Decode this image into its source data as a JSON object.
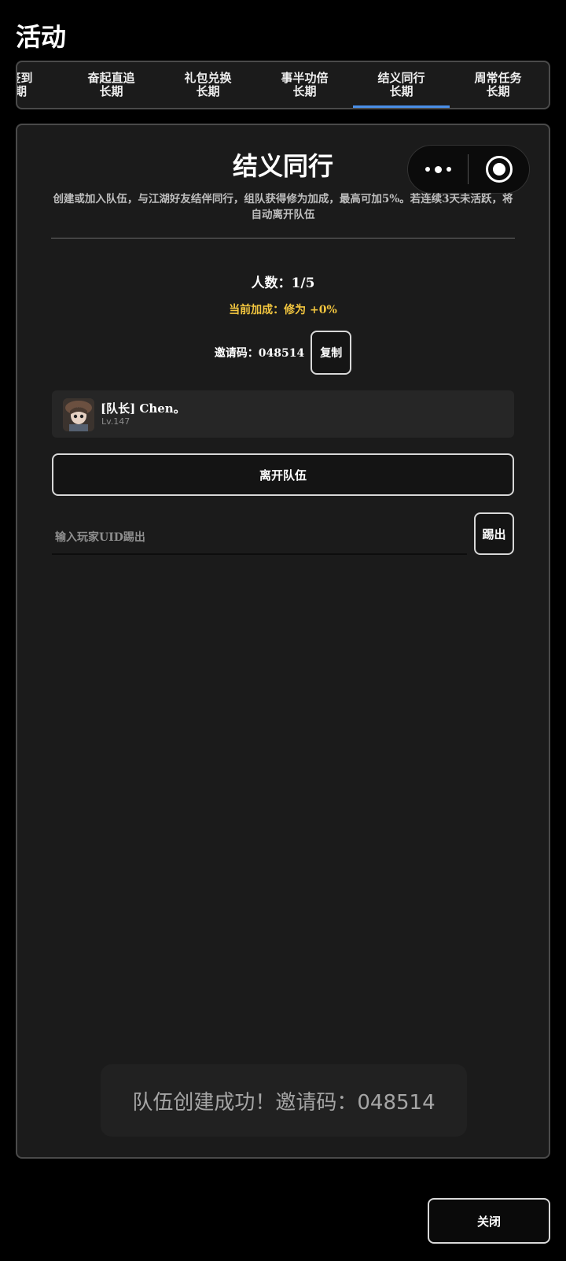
{
  "page": {
    "title": "活动"
  },
  "tabs": [
    {
      "label": "签到",
      "sub": "期",
      "active": false
    },
    {
      "label": "奋起直追",
      "sub": "长期",
      "active": false
    },
    {
      "label": "礼包兑换",
      "sub": "长期",
      "active": false
    },
    {
      "label": "事半功倍",
      "sub": "长期",
      "active": false
    },
    {
      "label": "结义同行",
      "sub": "长期",
      "active": true
    },
    {
      "label": "周常任务",
      "sub": "长期",
      "active": false
    }
  ],
  "capsule": {
    "menu_icon": "more-dots-icon",
    "close_icon": "target-ring-icon"
  },
  "team": {
    "title": "结义同行",
    "description": "创建或加入队伍，与江湖好友结伴同行，组队获得修为加成，最高可加5%。若连续3天未活跃，将自动离开队伍",
    "member_count": "人数：1/5",
    "bonus": "当前加成：修为 +0%",
    "invite": "邀请码：048514",
    "copy_label": "复制",
    "members": [
      {
        "name": "[队长] Chen。",
        "level": "Lv.147",
        "avatar_icon": "avatar-icon"
      }
    ],
    "leave_label": "离开队伍",
    "kick_placeholder": "输入玩家UID踢出",
    "kick_label": "踢出"
  },
  "toast": {
    "message": "队伍创建成功！邀请码：048514"
  },
  "footer": {
    "close_label": "关闭"
  },
  "colors": {
    "accent_tab": "#4a8fe8",
    "bonus_text": "#f3c63f",
    "panel_bg": "#1b1b1b"
  }
}
